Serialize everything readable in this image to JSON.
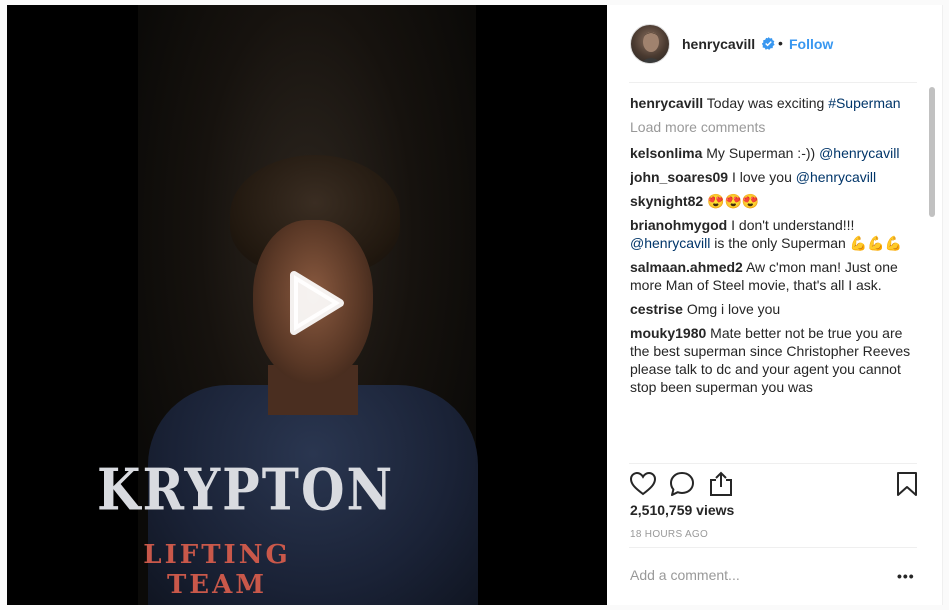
{
  "post": {
    "username": "henrycavill",
    "follow_label": "Follow",
    "separator": "•",
    "views": "2,510,759 views",
    "timestamp": "18 HOURS AGO",
    "add_comment_placeholder": "Add a comment...",
    "more_label": "•••"
  },
  "video": {
    "shirt_line1": "KRYPTON",
    "shirt_line2": "LIFTING TEAM"
  },
  "caption": {
    "user": "henrycavill",
    "text": " Today was exciting ",
    "tag": "#Superman"
  },
  "load_more": "Load more comments",
  "comments": [
    {
      "user": "kelsonlima",
      "pre": " My Superman :-)) ",
      "tag": "@henrycavill",
      "post": ""
    },
    {
      "user": "john_soares09",
      "pre": " I love you ",
      "tag": "@henrycavill",
      "post": ""
    },
    {
      "user": "skynight82",
      "pre": " 😍😍😍",
      "tag": "",
      "post": ""
    },
    {
      "user": "brianohmygod",
      "pre": " I don't understand!!! ",
      "tag": "@henrycavill",
      "post": " is the only Superman 💪💪💪"
    },
    {
      "user": "salmaan.ahmed2",
      "pre": " Aw c'mon man! Just one more Man of Steel movie, that's all I ask.",
      "tag": "",
      "post": ""
    },
    {
      "user": "cestrise",
      "pre": " Omg i love you",
      "tag": "",
      "post": ""
    },
    {
      "user": "mouky1980",
      "pre": " Mate better not be true you are the best superman since Christopher Reeves please talk to dc and your agent you cannot stop been superman you was",
      "tag": "",
      "post": ""
    }
  ],
  "colors": {
    "link": "#3897f0",
    "mention": "#003569",
    "muted": "#999999"
  }
}
